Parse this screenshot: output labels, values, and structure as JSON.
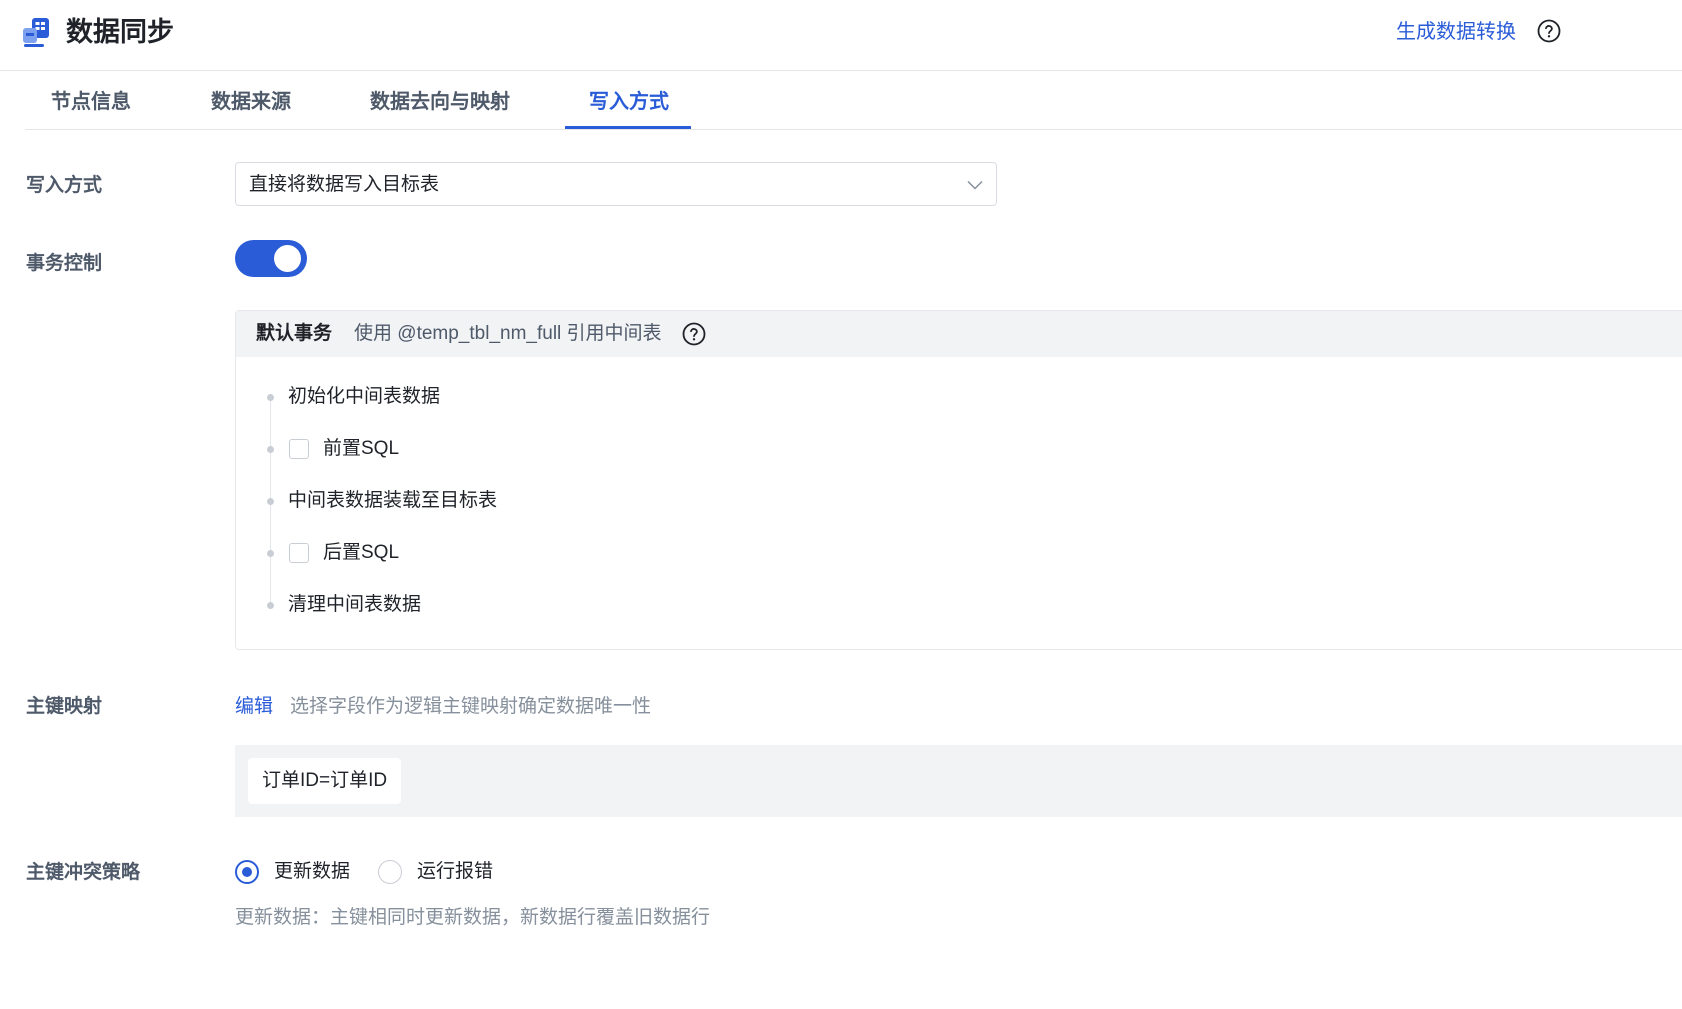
{
  "header": {
    "title": "数据同步",
    "generate_link": "生成数据转换"
  },
  "tabs": [
    {
      "label": "节点信息"
    },
    {
      "label": "数据来源"
    },
    {
      "label": "数据去向与映射"
    },
    {
      "label": "写入方式",
      "active": true
    }
  ],
  "form": {
    "write_mode": {
      "label": "写入方式",
      "value": "直接将数据写入目标表"
    },
    "transaction": {
      "label": "事务控制",
      "enabled": true,
      "panel_title": "默认事务",
      "panel_desc": "使用 @temp_tbl_nm_full 引用中间表",
      "steps": [
        {
          "text": "初始化中间表数据",
          "has_checkbox": false
        },
        {
          "text": "前置SQL",
          "has_checkbox": true,
          "checked": false
        },
        {
          "text": "中间表数据装载至目标表",
          "has_checkbox": false
        },
        {
          "text": "后置SQL",
          "has_checkbox": true,
          "checked": false
        },
        {
          "text": "清理中间表数据",
          "has_checkbox": false
        }
      ]
    },
    "pk_mapping": {
      "label": "主键映射",
      "edit_label": "编辑",
      "hint": "选择字段作为逻辑主键映射确定数据唯一性",
      "tag": "订单ID=订单ID"
    },
    "conflict": {
      "label": "主键冲突策略",
      "options": [
        {
          "label": "更新数据",
          "selected": true
        },
        {
          "label": "运行报错",
          "selected": false
        }
      ],
      "description": "更新数据：主键相同时更新数据，新数据行覆盖旧数据行"
    }
  },
  "colors": {
    "accent": "#2a5cd8",
    "text": "#1f2329",
    "label": "#4e5969",
    "muted": "#86909c",
    "panel_bg": "#f2f3f5"
  },
  "icons": [
    "data-sync-icon",
    "help-circle-icon",
    "chevron-down-icon"
  ]
}
